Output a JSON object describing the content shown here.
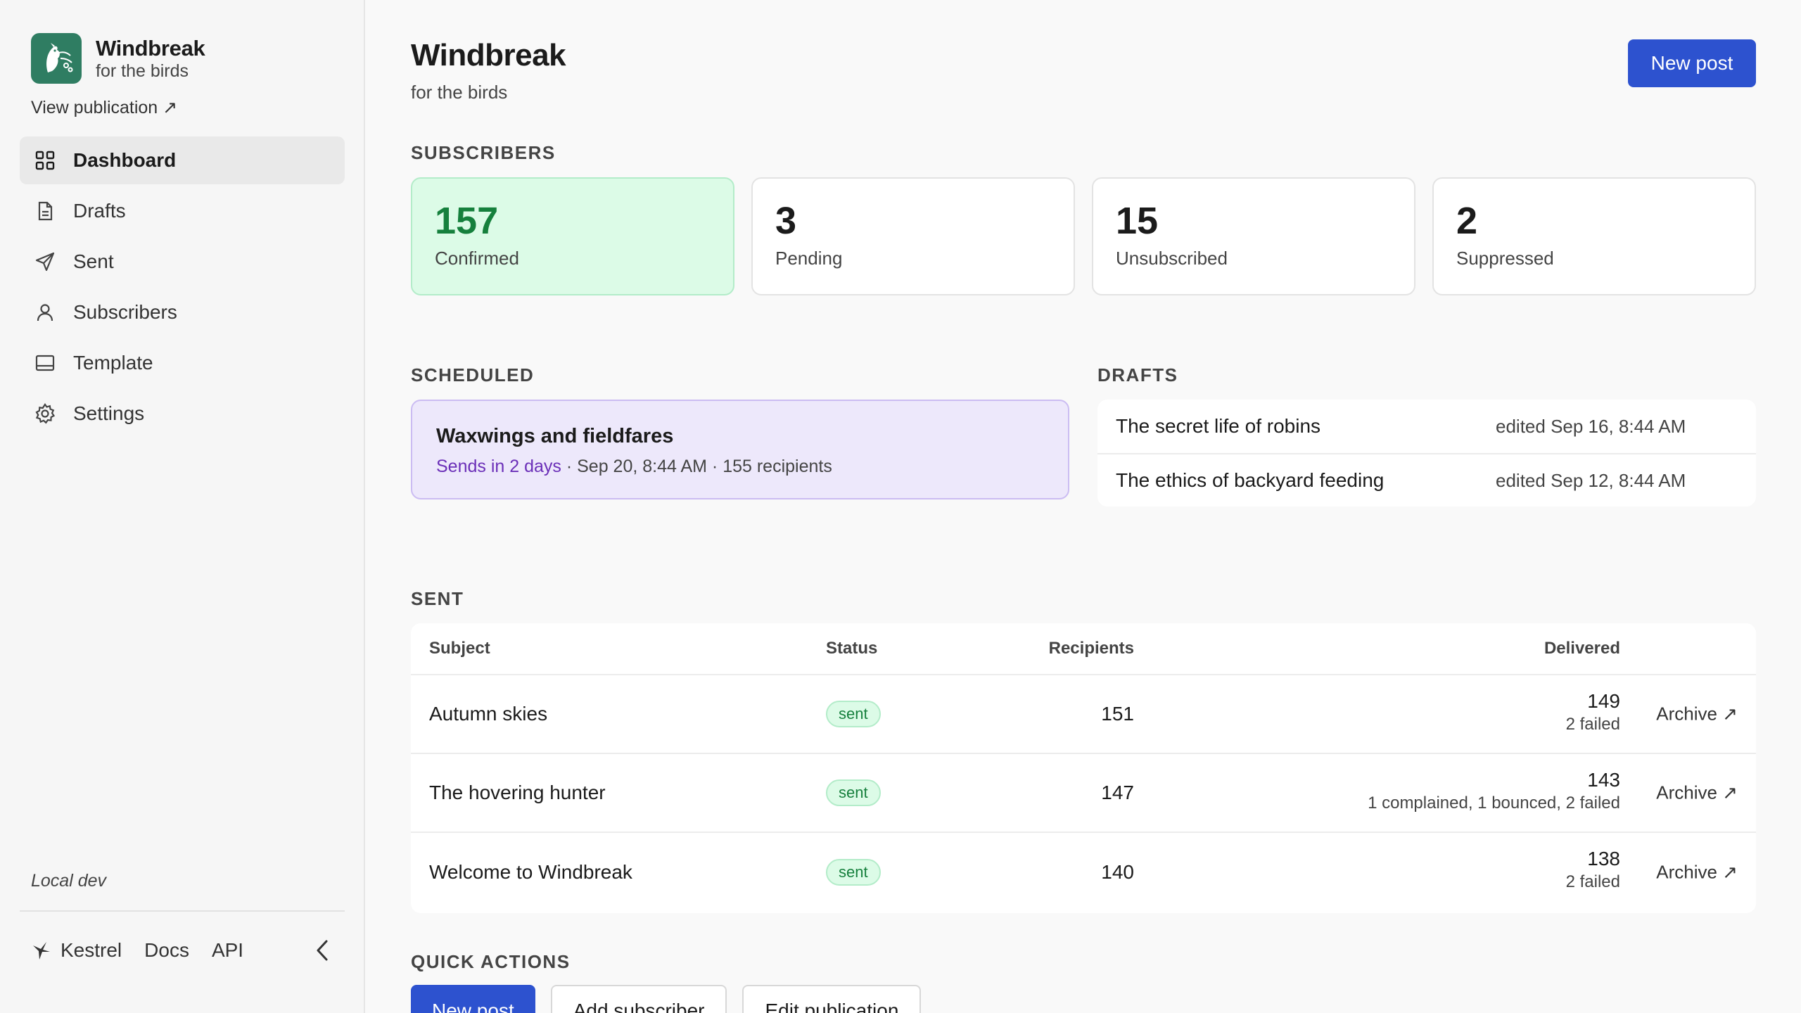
{
  "sidebar": {
    "brand_name": "Windbreak",
    "brand_tagline": "for the birds",
    "view_publication": "View publication ↗",
    "nav": [
      {
        "label": "Dashboard",
        "icon": "grid-icon",
        "active": true
      },
      {
        "label": "Drafts",
        "icon": "document-icon"
      },
      {
        "label": "Sent",
        "icon": "send-icon"
      },
      {
        "label": "Subscribers",
        "icon": "user-icon"
      },
      {
        "label": "Template",
        "icon": "layout-icon"
      },
      {
        "label": "Settings",
        "icon": "gear-icon"
      }
    ],
    "environment": "Local dev",
    "footer": {
      "kestrel": "Kestrel",
      "docs": "Docs",
      "api": "API"
    }
  },
  "header": {
    "title": "Windbreak",
    "subtitle": "for the birds",
    "new_post": "New post"
  },
  "subscribers": {
    "label": "SUBSCRIBERS",
    "stats": [
      {
        "value": "157",
        "label": "Confirmed"
      },
      {
        "value": "3",
        "label": "Pending"
      },
      {
        "value": "15",
        "label": "Unsubscribed"
      },
      {
        "value": "2",
        "label": "Suppressed"
      }
    ]
  },
  "scheduled": {
    "label": "SCHEDULED",
    "title": "Waxwings and fieldfares",
    "when": "Sends in 2 days",
    "details": " · Sep 20, 8:44 AM · 155 recipients"
  },
  "drafts": {
    "label": "DRAFTS",
    "items": [
      {
        "title": "The secret life of robins",
        "edited": "edited Sep 16, 8:44 AM"
      },
      {
        "title": "The ethics of backyard feeding",
        "edited": "edited Sep 12, 8:44 AM"
      }
    ]
  },
  "sent": {
    "label": "SENT",
    "columns": {
      "subject": "Subject",
      "status": "Status",
      "recipients": "Recipients",
      "delivered": "Delivered"
    },
    "rows": [
      {
        "subject": "Autumn skies",
        "status": "sent",
        "recipients": "151",
        "delivered": "149",
        "note": "2 failed",
        "archive": "Archive ↗"
      },
      {
        "subject": "The hovering hunter",
        "status": "sent",
        "recipients": "147",
        "delivered": "143",
        "note": "1 complained, 1 bounced, 2 failed",
        "archive": "Archive ↗"
      },
      {
        "subject": "Welcome to Windbreak",
        "status": "sent",
        "recipients": "140",
        "delivered": "138",
        "note": "2 failed",
        "archive": "Archive ↗"
      }
    ]
  },
  "quick_actions": {
    "label": "QUICK ACTIONS",
    "new_post": "New post",
    "add_subscriber": "Add subscriber",
    "edit_publication": "Edit publication"
  },
  "colors": {
    "accent": "#2d52cf",
    "brand": "#2f7d62",
    "confirmed_bg": "#dcfbe7",
    "scheduled_bg": "#ede8fb"
  }
}
